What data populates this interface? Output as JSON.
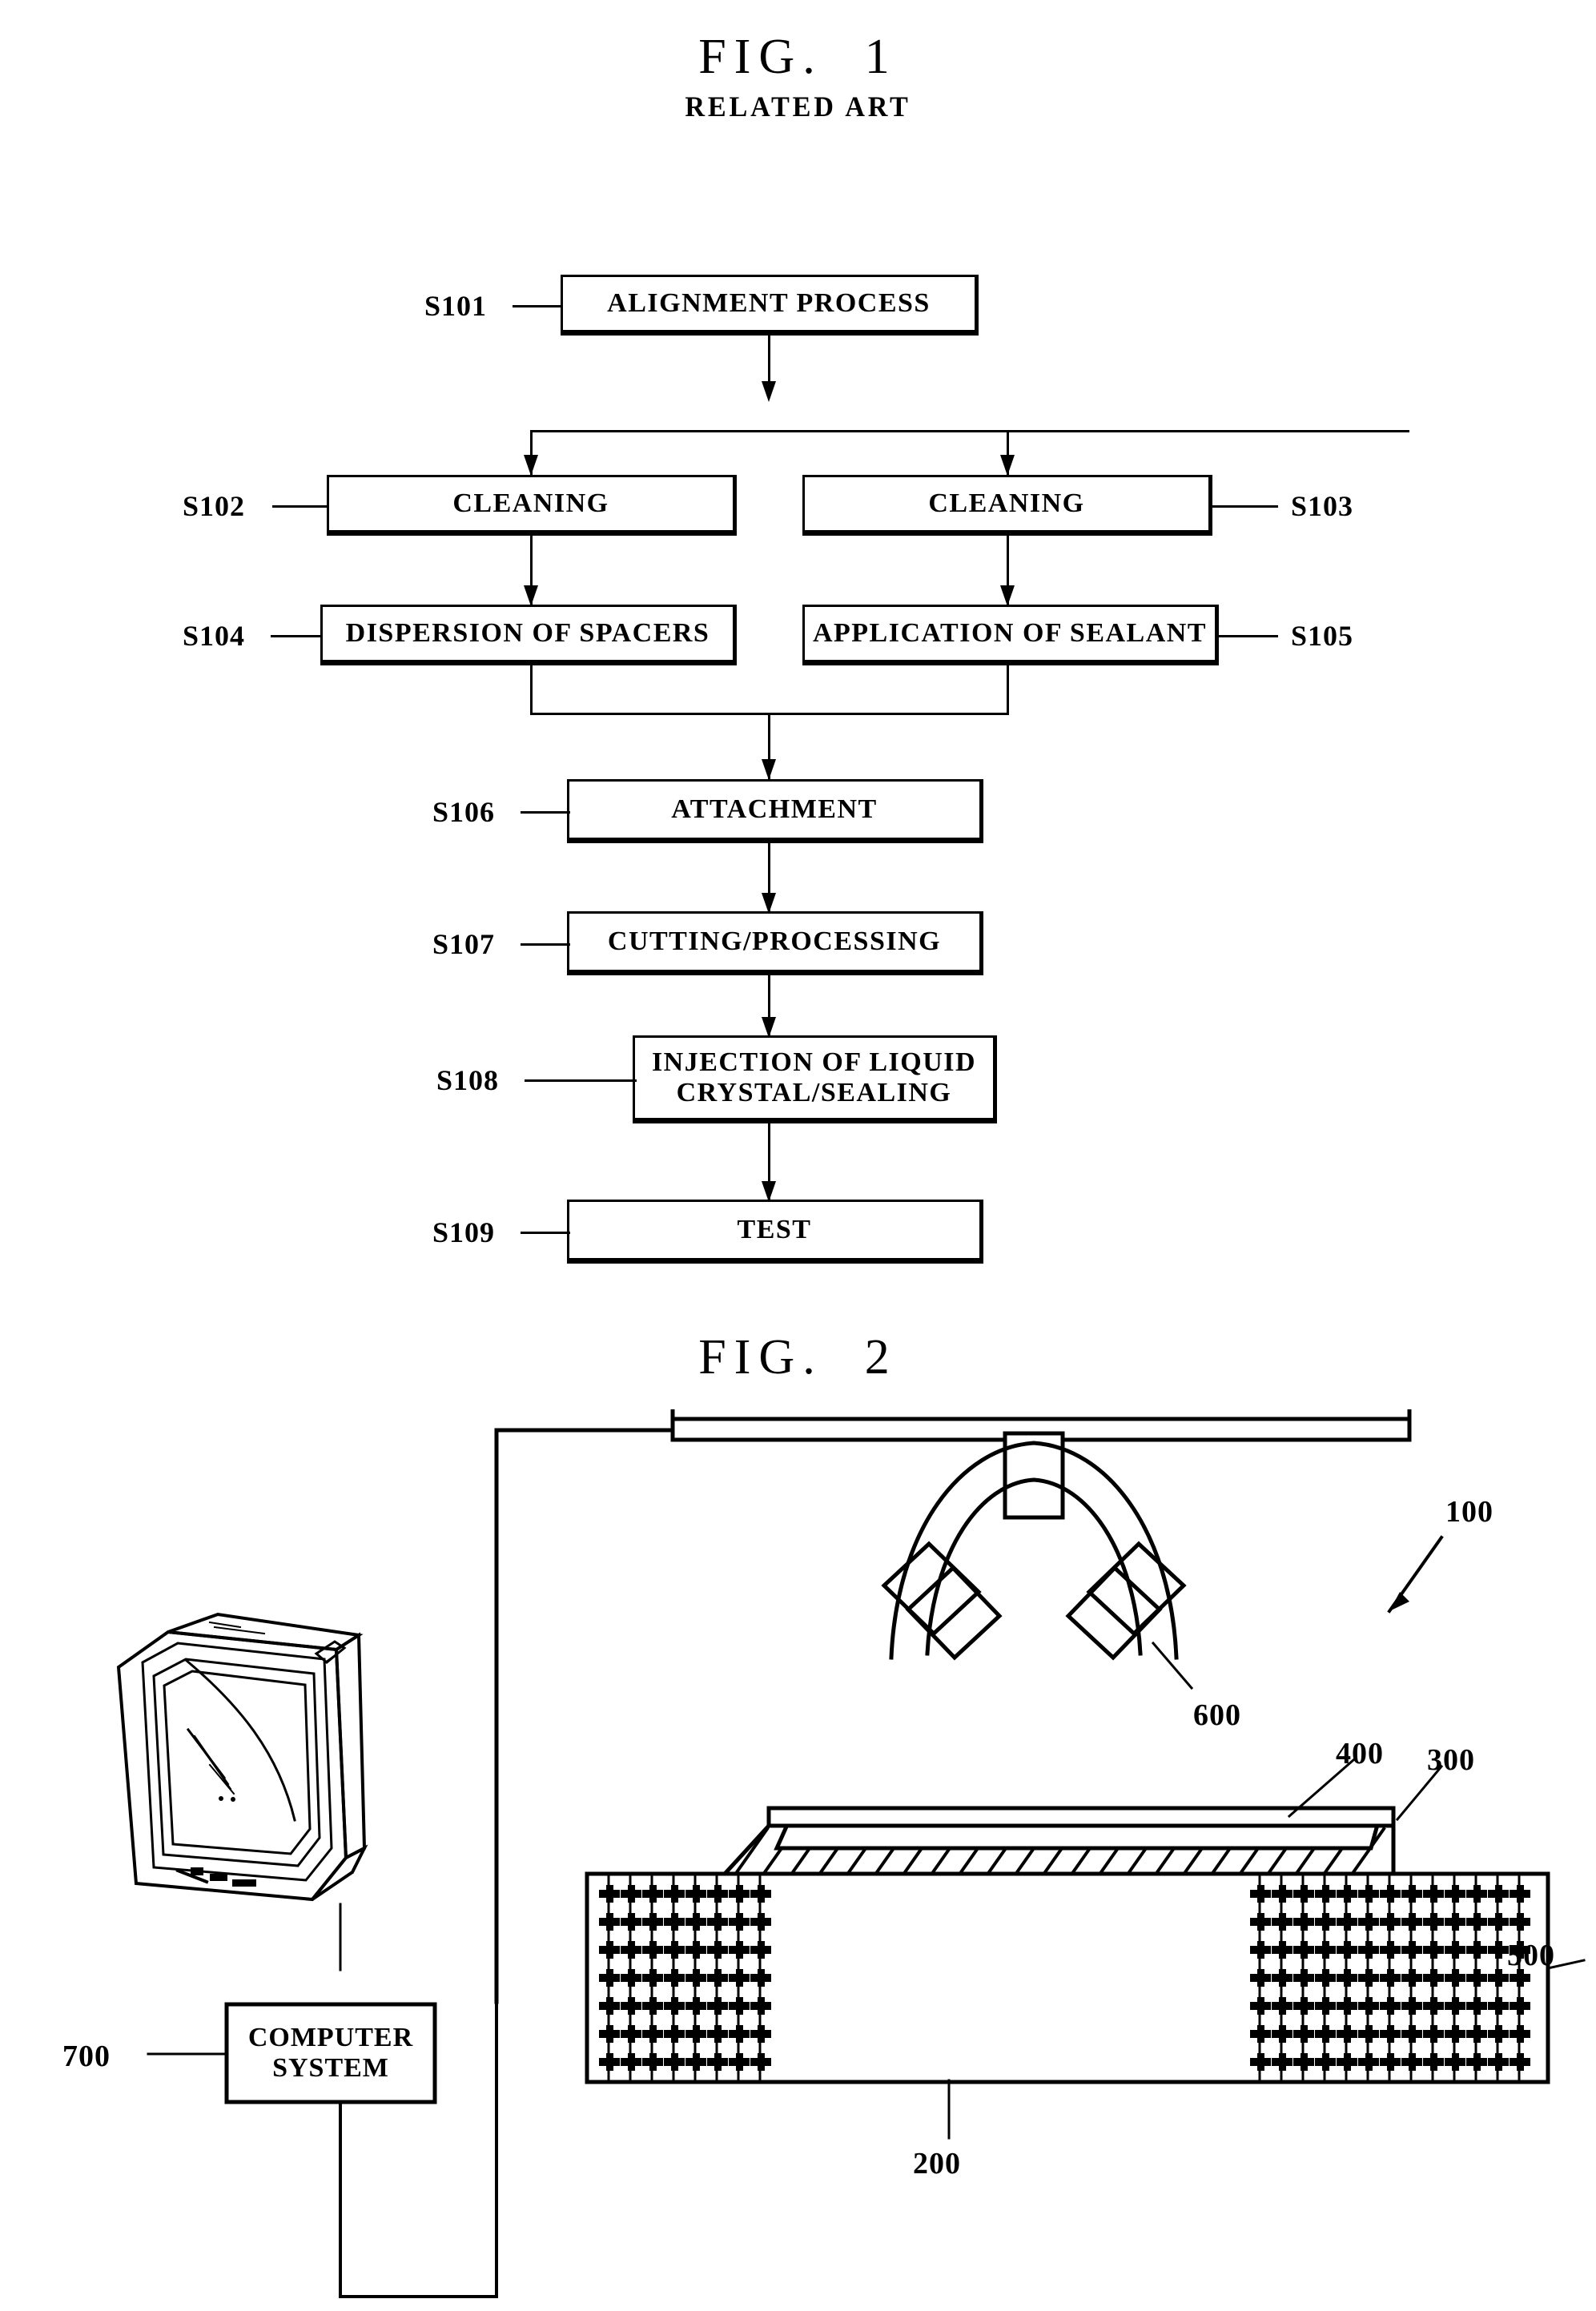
{
  "document": {
    "kind": "patent-drawing-sheet",
    "background_color": "#ffffff",
    "ink_color": "#000000"
  },
  "figures": [
    {
      "id": "fig1",
      "title": "FIG.  1",
      "title_main": "FIG.",
      "title_number": "1",
      "subtitle": "RELATED ART",
      "type": "process-flowchart"
    },
    {
      "id": "fig2",
      "title": "FIG.  2",
      "title_main": "FIG.",
      "title_number": "2",
      "subtitle": "",
      "type": "apparatus-schematic"
    }
  ],
  "fig1": {
    "title_main": "FIG.",
    "title_number": "1",
    "subtitle": "RELATED ART",
    "steps": [
      {
        "ref": "S101",
        "label": "ALIGNMENT PROCESS",
        "ref_side": "left"
      },
      {
        "ref": "S102",
        "label": "CLEANING",
        "ref_side": "left"
      },
      {
        "ref": "S103",
        "label": "CLEANING",
        "ref_side": "right"
      },
      {
        "ref": "S104",
        "label": "DISPERSION OF SPACERS",
        "ref_side": "left"
      },
      {
        "ref": "S105",
        "label": "APPLICATION OF SEALANT",
        "ref_side": "right"
      },
      {
        "ref": "S106",
        "label": "ATTACHMENT",
        "ref_side": "left"
      },
      {
        "ref": "S107",
        "label": "CUTTING/PROCESSING",
        "ref_side": "left"
      },
      {
        "ref": "S108",
        "label_line1": "INJECTION OF LIQUID",
        "label_line2": "CRYSTAL/SEALING",
        "ref_side": "left"
      },
      {
        "ref": "S109",
        "label": "TEST",
        "ref_side": "left"
      }
    ],
    "flow_description": "S101 splits to S102 and S103; S102 to S104; S103 to S105; S104 and S105 merge into S106; S106 to S107 to S108 to S109"
  },
  "fig2": {
    "title_main": "FIG.",
    "title_number": "2",
    "reference_numerals": [
      {
        "num": "100",
        "target": "upper-bar-assembly"
      },
      {
        "num": "200",
        "target": "stage-base"
      },
      {
        "num": "300",
        "target": "hatched-plate"
      },
      {
        "num": "400",
        "target": "upper-thin-plate"
      },
      {
        "num": "500",
        "target": "patterned-block"
      },
      {
        "num": "600",
        "target": "arc-sensor-head"
      },
      {
        "num": "700",
        "target": "computer-system-box"
      }
    ],
    "computer_system": {
      "label_line1": "COMPUTER",
      "label_line2": "SYSTEM",
      "ref": "700"
    },
    "monitor": {
      "name": "crt-monitor",
      "description": "line-art CRT display in three-quarter perspective connected by cable to the computer system"
    }
  }
}
